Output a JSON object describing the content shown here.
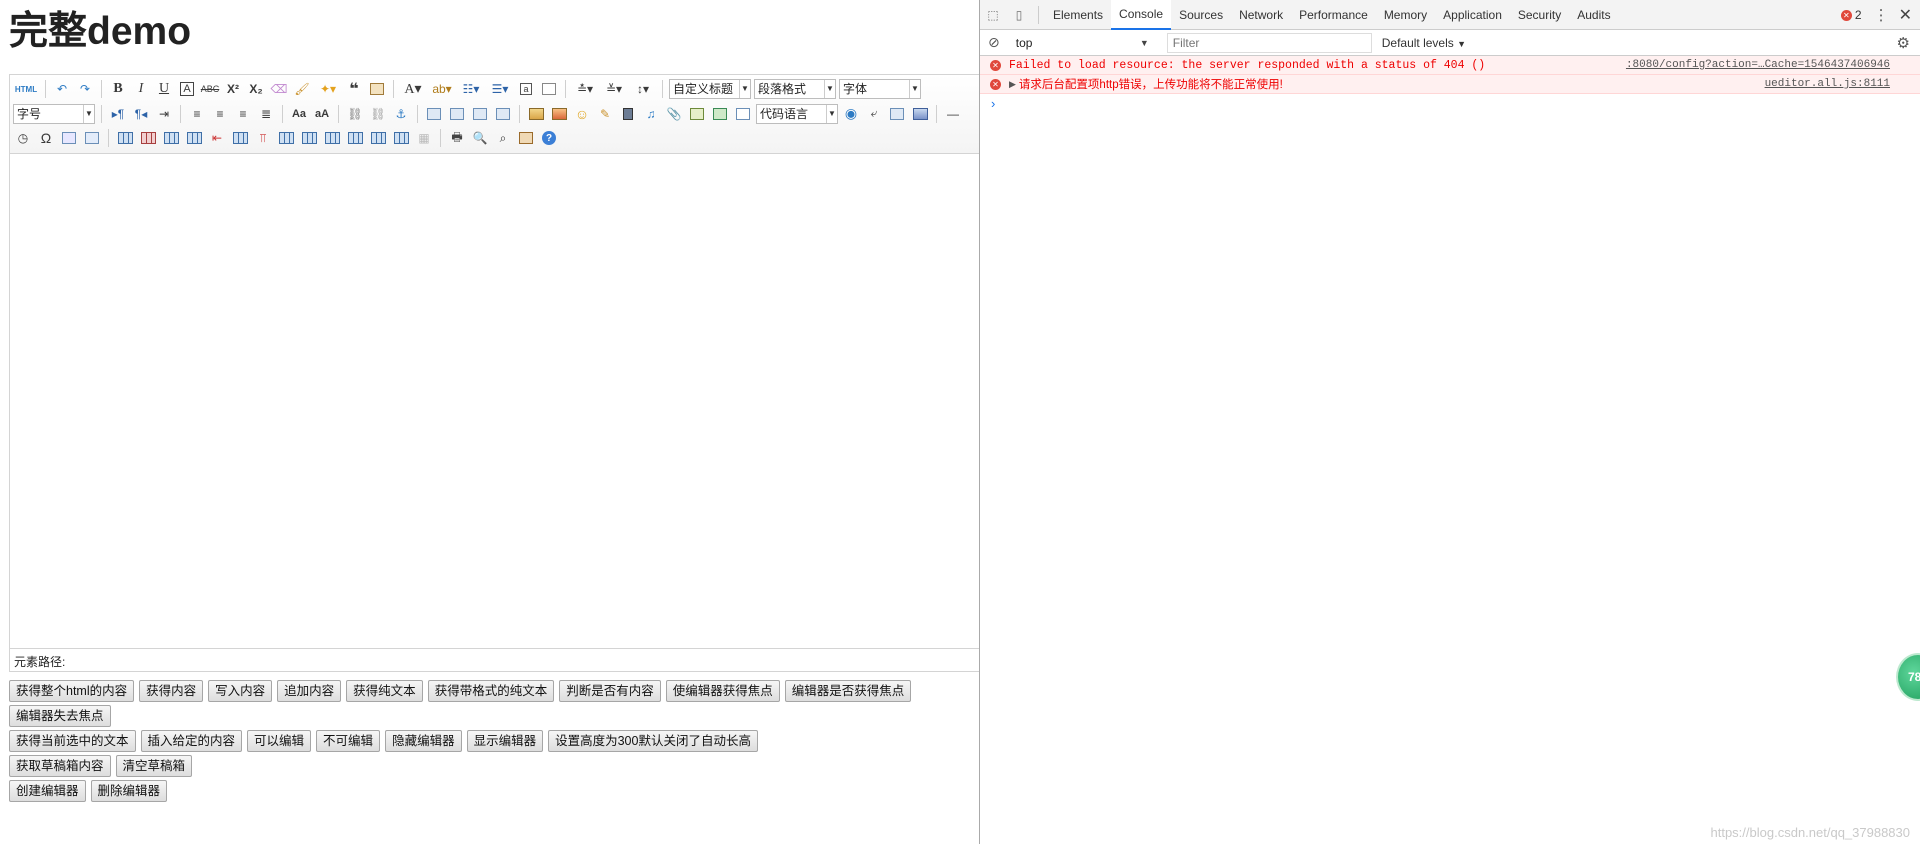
{
  "page": {
    "title": "完整demo",
    "toolbar": {
      "html_label": "HTML",
      "custom_heading": "自定义标题",
      "paragraph_format": "段落格式",
      "font_family": "字体",
      "font_size": "字号",
      "code_language": "代码语言"
    },
    "path_label": "元素路径:",
    "buttons": {
      "row1": [
        "获得整个html的内容",
        "获得内容",
        "写入内容",
        "追加内容",
        "获得纯文本",
        "获得带格式的纯文本",
        "判断是否有内容",
        "使编辑器获得焦点",
        "编辑器是否获得焦点"
      ],
      "row2": [
        "编辑器失去焦点"
      ],
      "row3": [
        "获得当前选中的文本",
        "插入给定的内容",
        "可以编辑",
        "不可编辑",
        "隐藏编辑器",
        "显示编辑器",
        "设置高度为300默认关闭了自动长高"
      ],
      "row4": [
        "获取草稿箱内容",
        "清空草稿箱"
      ],
      "row5": [
        "创建编辑器",
        "删除编辑器"
      ]
    }
  },
  "devtools": {
    "tabs": [
      "Elements",
      "Console",
      "Sources",
      "Network",
      "Performance",
      "Memory",
      "Application",
      "Security",
      "Audits"
    ],
    "active_tab": "Console",
    "error_count": "2",
    "context": "top",
    "filter_placeholder": "Filter",
    "levels": "Default levels",
    "messages": [
      {
        "text": "Failed to load resource: the server responded with a status of 404 ()",
        "source": ":8080/config?action=…Cache=1546437406946"
      },
      {
        "text": "请求后台配置项http错误，上传功能将不能正常使用!",
        "source": "ueditor.all.js:8111"
      }
    ],
    "prompt": "›"
  },
  "badge": "78",
  "watermark": "https://blog.csdn.net/qq_37988830",
  "colors": {
    "error": "#ee0000",
    "error_bg": "#fff0f0",
    "active_tab": "#1a73e8",
    "badge": "#1f9e5c"
  }
}
